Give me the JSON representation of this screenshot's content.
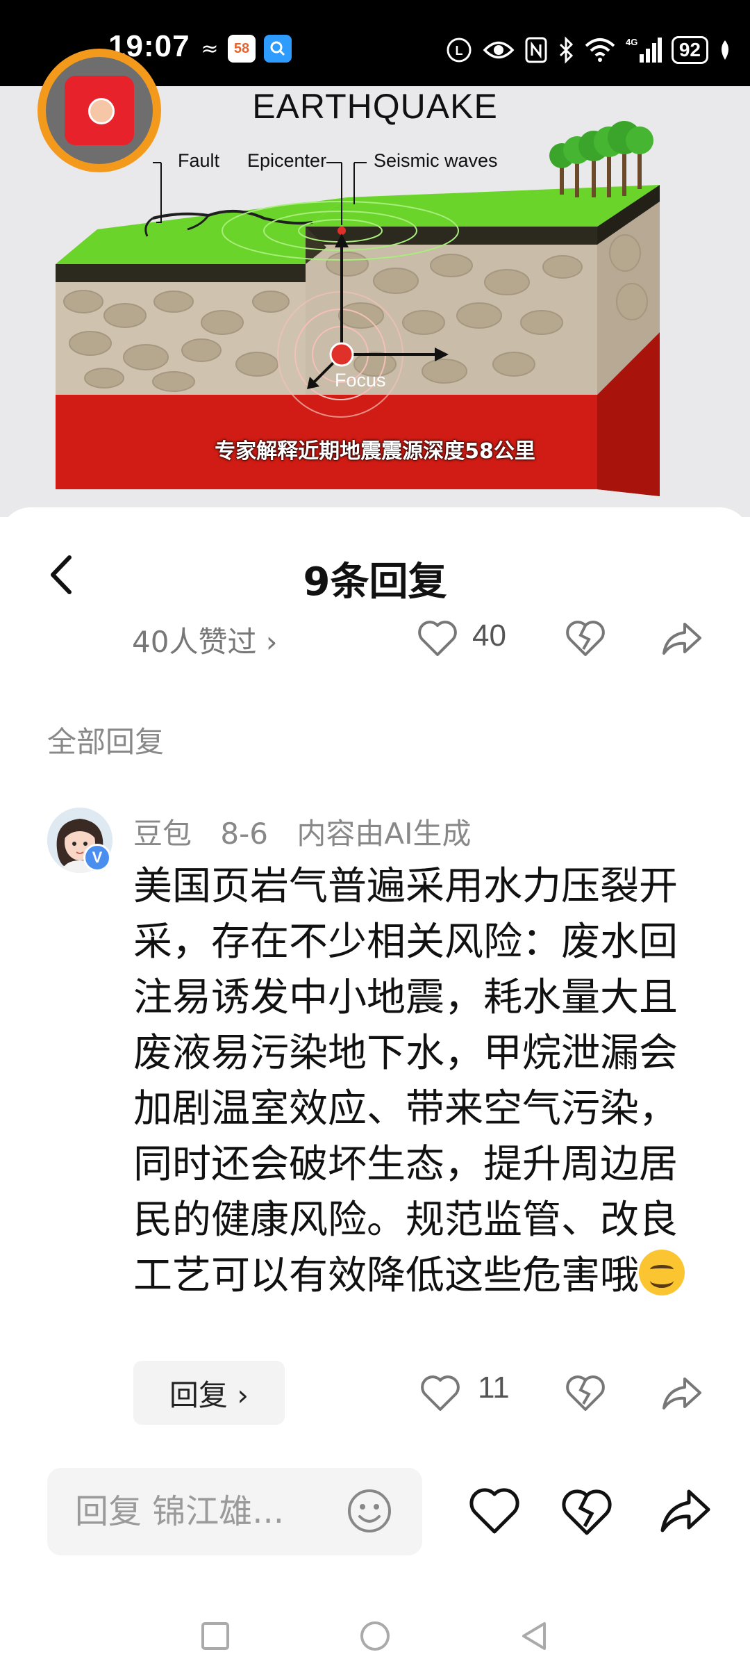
{
  "status_bar": {
    "time": "19:07",
    "battery": "92",
    "network": "4G"
  },
  "video": {
    "title": "EARTHQUAKE",
    "labels": {
      "fault": "Fault",
      "epicenter": "Epicenter",
      "seismic": "Seismic waves",
      "focus": "Focus"
    },
    "subtitle": "专家解释近期地震震源深度58公里"
  },
  "sheet": {
    "title": "9条回复",
    "liked_by": "40人赞过 ›",
    "likes": "40",
    "section_label": "全部回复"
  },
  "comment": {
    "author": "豆包",
    "date": "8-6",
    "tag": "内容由AI生成",
    "avatar_badge": "V",
    "text": "美国页岩气普遍采用水力压裂开采，存在不少相关风险：废水回注易诱发中小地震，耗水量大且废液易污染地下水，甲烷泄漏会加剧温室效应、带来空气污染，同时还会破坏生态，提升周边居民的健康风险。规范监管、改良工艺可以有效降低这些危害哦",
    "reply_label": "回复 ›",
    "likes": "11"
  },
  "composer": {
    "placeholder": "回复 锦江雄..."
  },
  "colors": {
    "accent_ring": "#f39a1d",
    "ground_top": "#6bd42a",
    "magma": "#d01c14"
  }
}
